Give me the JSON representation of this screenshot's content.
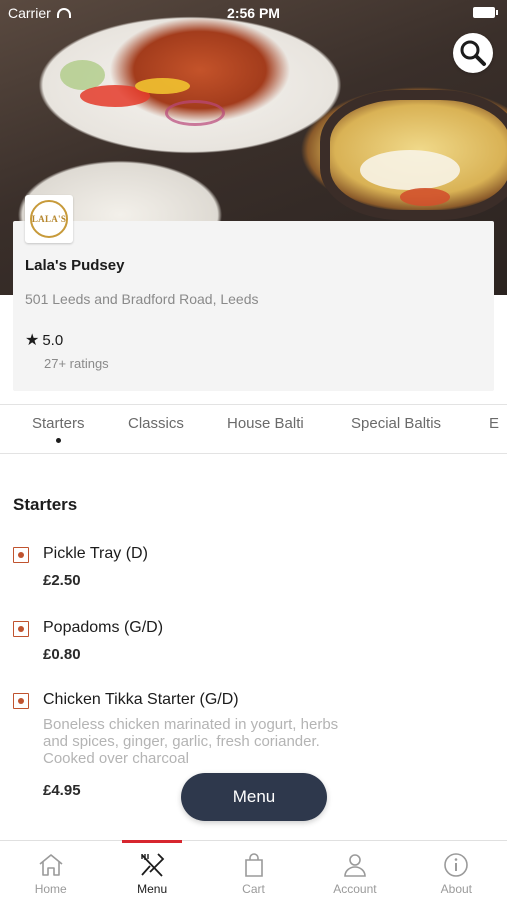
{
  "status_bar": {
    "carrier": "Carrier",
    "time": "2:56 PM"
  },
  "restaurant": {
    "logo_text": "LALA'S",
    "name": "Lala's Pudsey",
    "address": "501 Leeds and Bradford Road, Leeds",
    "rating": "5.0",
    "ratings_count": "27+ ratings"
  },
  "categories": [
    {
      "label": "Starters",
      "active": true
    },
    {
      "label": "Classics",
      "active": false
    },
    {
      "label": "House Balti",
      "active": false
    },
    {
      "label": "Special Baltis",
      "active": false
    },
    {
      "label": "E",
      "active": false
    }
  ],
  "menu": {
    "section_title": "Starters",
    "items": [
      {
        "name": "Pickle Tray (D)",
        "price": "£2.50",
        "description": ""
      },
      {
        "name": "Popadoms (G/D)",
        "price": "£0.80",
        "description": ""
      },
      {
        "name": "Chicken Tikka Starter (G/D)",
        "price": "£4.95",
        "description": "Boneless chicken marinated in yogurt, herbs and spices, ginger, garlic, fresh coriander. Cooked over charcoal"
      }
    ]
  },
  "float_button": {
    "label": "Menu"
  },
  "bottom_nav": [
    {
      "label": "Home",
      "icon": "home-icon",
      "active": false
    },
    {
      "label": "Menu",
      "icon": "fork-knife-icon",
      "active": true
    },
    {
      "label": "Cart",
      "icon": "bag-icon",
      "active": false
    },
    {
      "label": "Account",
      "icon": "user-icon",
      "active": false
    },
    {
      "label": "About",
      "icon": "info-icon",
      "active": false
    }
  ],
  "colors": {
    "accent_red": "#d7262f",
    "checkbox": "#c0532f",
    "float_button": "#2e384c"
  }
}
